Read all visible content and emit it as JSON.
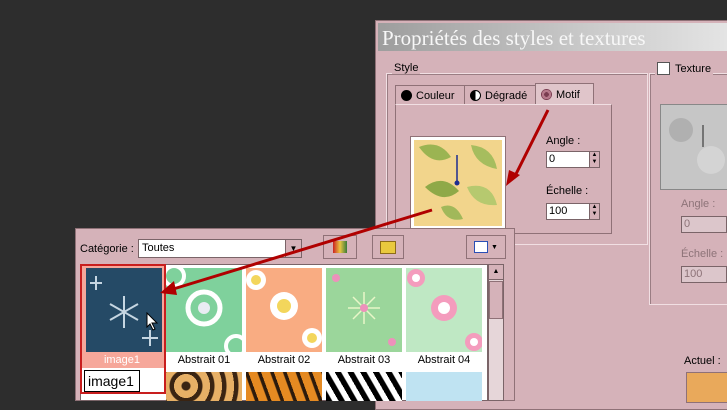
{
  "dialog": {
    "title": "Propriétés des styles et textures",
    "style_group_label": "Style",
    "tabs": [
      {
        "label": "Couleur",
        "icon": "solid-circle-icon"
      },
      {
        "label": "Dégradé",
        "icon": "gradient-circle-icon"
      },
      {
        "label": "Motif",
        "icon": "pattern-circle-icon",
        "active": true
      }
    ],
    "angle_label": "Angle :",
    "angle_value": "0",
    "scale_label": "Échelle :",
    "scale_value": "100",
    "texture_label": "Texture",
    "texture_checked": false,
    "texture_angle_label": "Angle :",
    "texture_angle_value": "0",
    "texture_scale_label": "Échelle :",
    "texture_scale_value": "100",
    "current_label": "Actuel :"
  },
  "picker": {
    "category_label": "Catégorie :",
    "category_value": "Toutes",
    "tooltip": "image1",
    "thumbnails": [
      {
        "label": "image1",
        "selected": true
      },
      {
        "label": "Abstrait 01"
      },
      {
        "label": "Abstrait 02"
      },
      {
        "label": "Abstrait 03"
      },
      {
        "label": "Abstrait 04"
      }
    ]
  },
  "colors": {
    "dialog_bg": "#d5b2b9",
    "arrow": "#b00000",
    "selection_highlight": "#f6a79a"
  }
}
